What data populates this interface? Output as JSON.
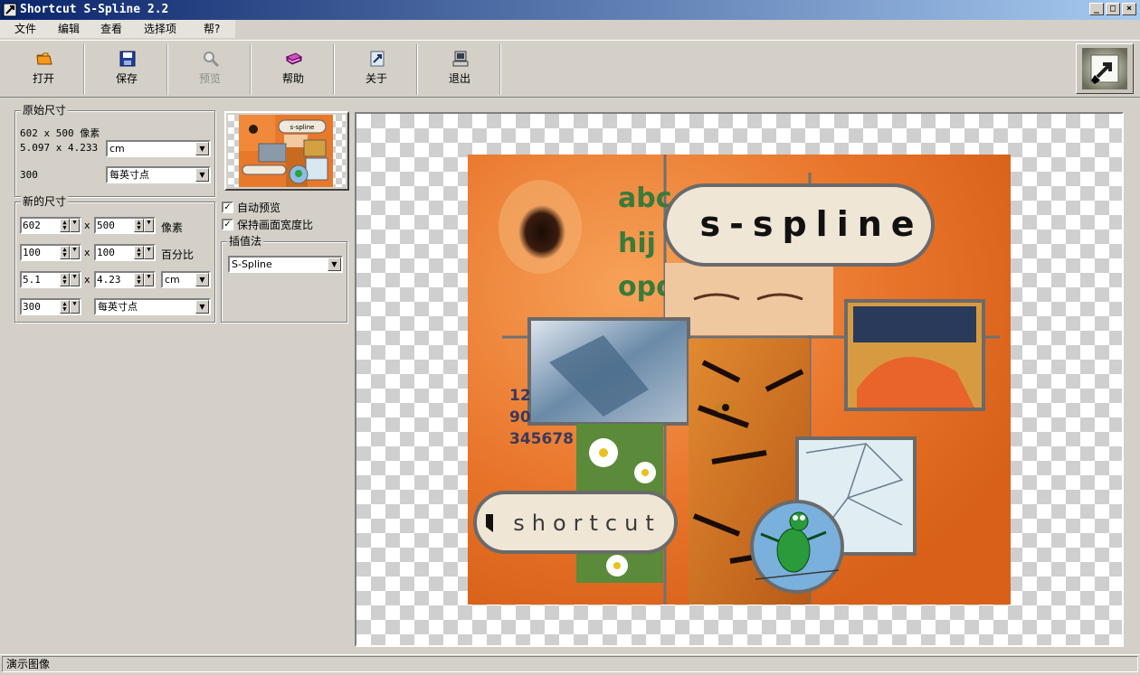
{
  "window": {
    "title": "Shortcut S-Spline 2.2",
    "buttons": {
      "minimize": "_",
      "maximize": "□",
      "close": "×"
    }
  },
  "menu": [
    {
      "label": "文件"
    },
    {
      "label": "编辑"
    },
    {
      "label": "查看"
    },
    {
      "label": "选择项"
    },
    {
      "label": "帮?"
    }
  ],
  "toolbar": {
    "open": "打开",
    "save": "保存",
    "preview": "预览",
    "help": "帮助",
    "about": "关于",
    "exit": "退出"
  },
  "original_size": {
    "title": "原始尺寸",
    "pixels": "602 x 500 像素",
    "physical": "5.097 x 4.233",
    "physical_unit": "cm",
    "resolution": "300",
    "resolution_unit": "每英寸点"
  },
  "new_size": {
    "title": "新的尺寸",
    "width_px": "602",
    "height_px": "500",
    "px_unit": "像素",
    "width_pct": "100",
    "height_pct": "100",
    "pct_unit": "百分比",
    "width_cm": "5.1",
    "height_cm": "4.23",
    "cm_unit": "cm",
    "resolution": "300",
    "resolution_unit": "每英寸点",
    "times": "x"
  },
  "options": {
    "auto_preview": {
      "label": "自动预览",
      "checked": true
    },
    "keep_aspect": {
      "label": "保持画面宽度比",
      "checked": true
    }
  },
  "interpolation": {
    "title": "插值法",
    "method": "S-Spline"
  },
  "image": {
    "logo_text": "s-spline",
    "shortcut_text": "shortcut",
    "letters": [
      "abc",
      "hij",
      "opqr"
    ],
    "numbers": [
      "12",
      "90",
      "345678"
    ]
  },
  "status": {
    "text": "演示图像"
  }
}
